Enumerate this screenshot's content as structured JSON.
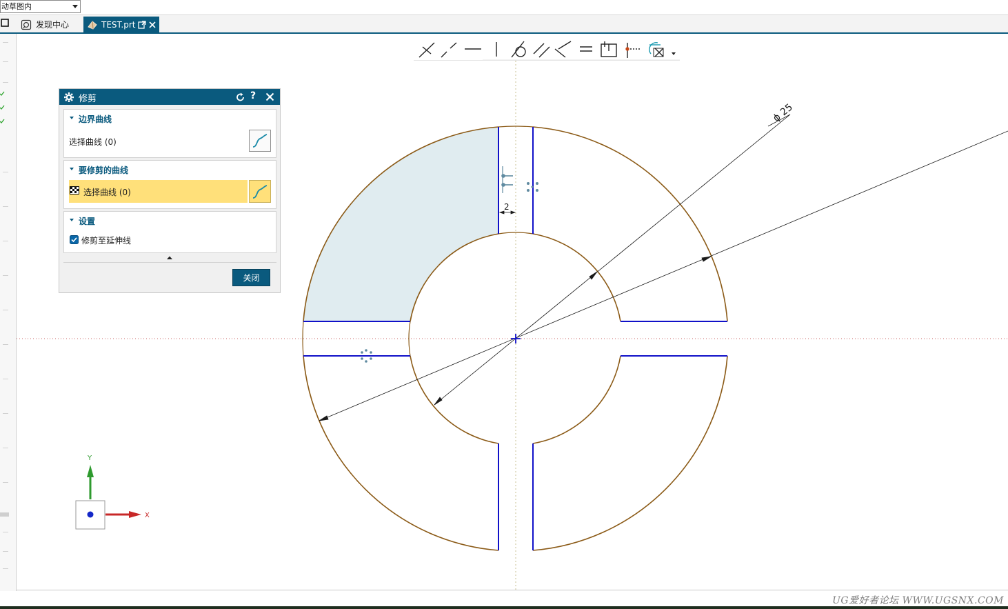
{
  "topbar": {
    "filter_value": "动草图内"
  },
  "tabs": [
    {
      "label": "发现中心"
    },
    {
      "label": "TEST.prt"
    }
  ],
  "dialog": {
    "title": "修剪",
    "sections": [
      {
        "header": "边界曲线",
        "row_label": "选择曲线 (0)"
      },
      {
        "header": "要修剪的曲线",
        "row_label": "选择曲线 (0)"
      },
      {
        "header": "设置",
        "checkbox_label": "修剪至延伸线",
        "checkbox_checked": true
      }
    ],
    "close_label": "关闭"
  },
  "drawing": {
    "diameter_label": "ϕ 25",
    "gap_label": "2",
    "axis_x": "X",
    "axis_y": "Y",
    "colors": {
      "arc": "#8b5a16",
      "line": "#1010c8",
      "fill": "#e0ecf0",
      "accent": "#0a5a7e",
      "highlight": "#ffe07a",
      "centerline": "#c86464"
    }
  },
  "watermark": "UG爱好者论坛 WWW.UGSNX.COM"
}
